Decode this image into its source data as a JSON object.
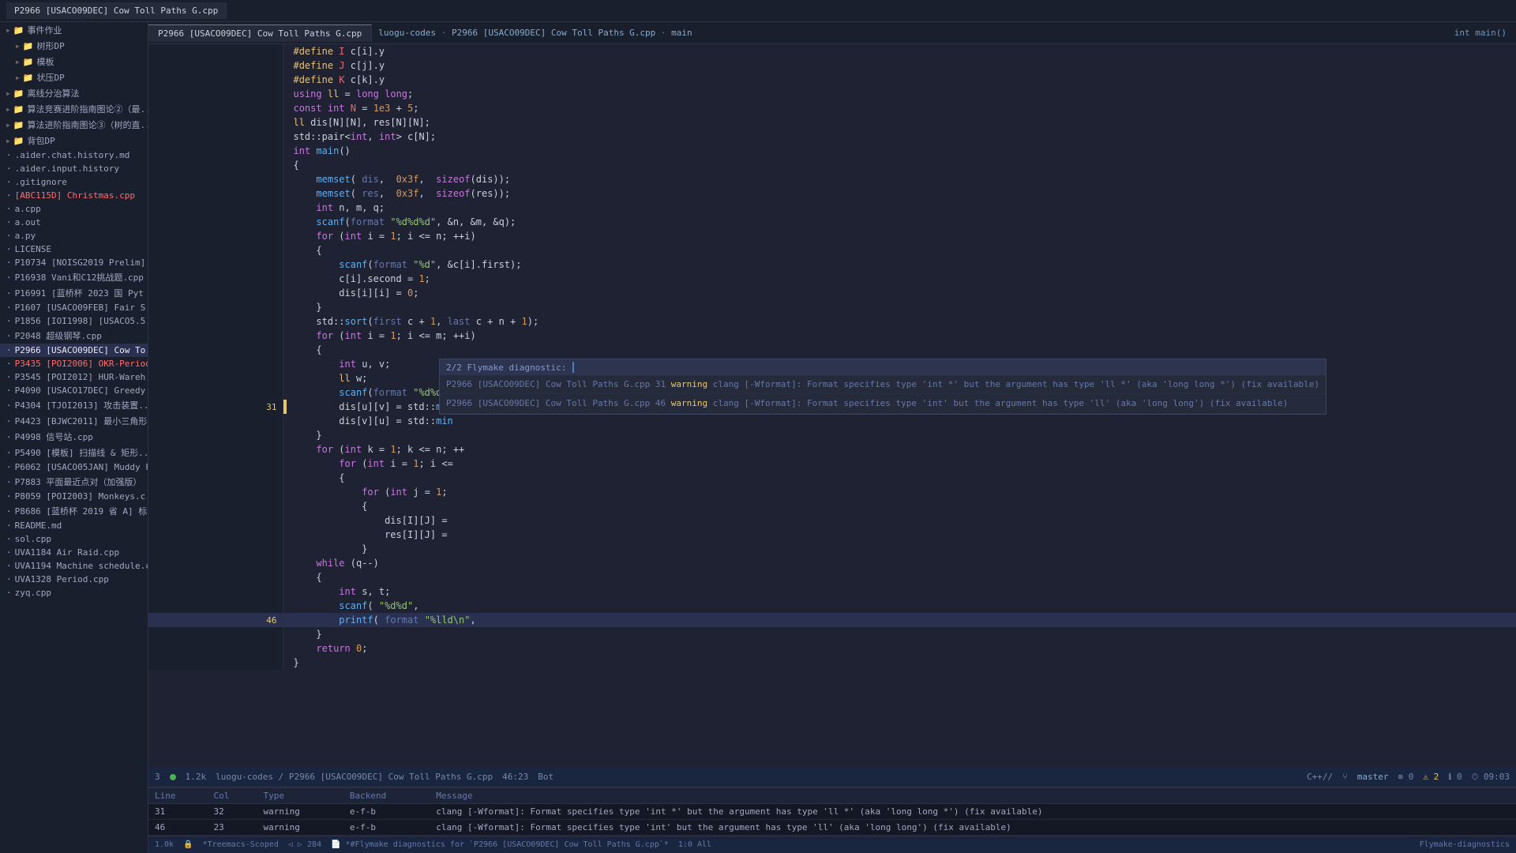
{
  "titleBar": {
    "tab": "P2966 [USACO09DEC] Cow Toll Paths G.cpp"
  },
  "tabBar": {
    "tabs": [
      {
        "label": "P2966 [USACO09DEC] Cow Toll Paths G.cpp",
        "active": true
      },
      {
        "label": "main",
        "active": false
      }
    ],
    "breadcrumb": "luogu-codes · P2966 [USACO09DEC] Cow Toll Paths G.cpp · main"
  },
  "sidebar": {
    "items": [
      {
        "label": "事件作业",
        "indent": 0,
        "expandable": true,
        "icon": "folder"
      },
      {
        "label": "树形DP",
        "indent": 1,
        "expandable": true,
        "icon": "folder"
      },
      {
        "label": "模板",
        "indent": 1,
        "expandable": true,
        "icon": "folder"
      },
      {
        "label": "状压DP",
        "indent": 1,
        "expandable": true,
        "icon": "folder"
      },
      {
        "label": "离线分治算法",
        "indent": 0,
        "expandable": true,
        "icon": "folder"
      },
      {
        "label": "算法竞赛进阶指南图论②（最...",
        "indent": 0,
        "expandable": true,
        "icon": "folder"
      },
      {
        "label": "算法进阶指南图论③（树的直...",
        "indent": 0,
        "expandable": true,
        "icon": "folder"
      },
      {
        "label": "背包DP",
        "indent": 0,
        "expandable": true,
        "icon": "folder"
      },
      {
        "label": ".aider.chat.history.md",
        "indent": 0,
        "icon": "file"
      },
      {
        "label": ".aider.input.history",
        "indent": 0,
        "icon": "file"
      },
      {
        "label": ".gitignore",
        "indent": 0,
        "icon": "file"
      },
      {
        "label": "[ABC115D] Christmas.cpp",
        "indent": 0,
        "icon": "file",
        "highlighted": true
      },
      {
        "label": "a.cpp",
        "indent": 0,
        "icon": "file"
      },
      {
        "label": "a.out",
        "indent": 0,
        "icon": "file"
      },
      {
        "label": "a.py",
        "indent": 0,
        "icon": "file"
      },
      {
        "label": "LICENSE",
        "indent": 0,
        "icon": "file"
      },
      {
        "label": "P10734 [NOISG2019 Prelim]...",
        "indent": 0,
        "icon": "file"
      },
      {
        "label": "P16938 Vani和C12挑战题.cpp",
        "indent": 0,
        "icon": "file"
      },
      {
        "label": "P16991 [蓝桥杯 2023 国 Pyt",
        "indent": 0,
        "icon": "file"
      },
      {
        "label": "P1607 [USACO09FEB] Fair S...",
        "indent": 0,
        "icon": "file"
      },
      {
        "label": "P1856 [IOI1998] [USACO5.5..",
        "indent": 0,
        "icon": "file"
      },
      {
        "label": "P2048 超级钢琴.cpp",
        "indent": 0,
        "icon": "file"
      },
      {
        "label": "P2966 [USACO09DEC] Cow To...",
        "indent": 0,
        "icon": "file",
        "active": true
      },
      {
        "label": "P3435 [POI2006] OKR-Period...",
        "indent": 0,
        "icon": "file",
        "highlighted": true
      },
      {
        "label": "P3545 [POI2012] HUR-Wareh...",
        "indent": 0,
        "icon": "file"
      },
      {
        "label": "P4090 [USACO17DEC] Greedy...",
        "indent": 0,
        "icon": "file"
      },
      {
        "label": "P4304 [TJOI2013] 攻击装置...",
        "indent": 0,
        "icon": "file"
      },
      {
        "label": "P4423 [BJWC2011] 最小三角形...",
        "indent": 0,
        "icon": "file"
      },
      {
        "label": "P4998 信号站.cpp",
        "indent": 0,
        "icon": "file"
      },
      {
        "label": "P5490 [模板] 扫描线 & 矩形...",
        "indent": 0,
        "icon": "file"
      },
      {
        "label": "P6062 [USACO05JAN] Muddy F..",
        "indent": 0,
        "icon": "file"
      },
      {
        "label": "P7883 平面最近点对（加强版）",
        "indent": 0,
        "icon": "file"
      },
      {
        "label": "P8059 [POI2003] Monkeys.c...",
        "indent": 0,
        "icon": "file"
      },
      {
        "label": "P8686 [蓝桥杯 2019 省 A] 标...",
        "indent": 0,
        "icon": "file"
      },
      {
        "label": "README.md",
        "indent": 0,
        "icon": "file"
      },
      {
        "label": "sol.cpp",
        "indent": 0,
        "icon": "file"
      },
      {
        "label": "UVA1184 Air Raid.cpp",
        "indent": 0,
        "icon": "file"
      },
      {
        "label": "UVA1194 Machine schedule.c...",
        "indent": 0,
        "icon": "file"
      },
      {
        "label": "UVA1328 Period.cpp",
        "indent": 0,
        "icon": "file"
      },
      {
        "label": "zyq.cpp",
        "indent": 0,
        "icon": "file"
      }
    ]
  },
  "codeLines": [
    {
      "num": "",
      "content": "#define I c[i].y",
      "type": "code"
    },
    {
      "num": "",
      "content": "#define J c[j].y",
      "type": "code"
    },
    {
      "num": "",
      "content": "#define K c[k].y",
      "type": "code"
    },
    {
      "num": "",
      "content": "using ll = long long;",
      "type": "code",
      "warning": false
    },
    {
      "num": "",
      "content": "const int N = 1e3 + 5;",
      "type": "code"
    },
    {
      "num": "",
      "content": "ll dis[N][N], res[N][N];",
      "type": "code"
    },
    {
      "num": "",
      "content": "std::pair<int, int> c[N];",
      "type": "code"
    },
    {
      "num": "",
      "content": "int main()",
      "type": "code"
    },
    {
      "num": "",
      "content": "{",
      "type": "code"
    },
    {
      "num": "",
      "content": "    memset(dis,  0x3f,  sizeof(dis));",
      "type": "code"
    },
    {
      "num": "",
      "content": "    memset(res,  0x3f,  sizeof(res));",
      "type": "code"
    },
    {
      "num": "",
      "content": "    int n, m, q;",
      "type": "code"
    },
    {
      "num": "",
      "content": "    scanf(\"%d%d%d\", &n, &m, &q);",
      "type": "code"
    },
    {
      "num": "",
      "content": "    for (int i = 1; i <= n; ++i)",
      "type": "code"
    },
    {
      "num": "",
      "content": "    {",
      "type": "code"
    },
    {
      "num": "",
      "content": "        scanf(\"%d\", &c[i].first);",
      "type": "code"
    },
    {
      "num": "",
      "content": "        c[i].second = 1;",
      "type": "code"
    },
    {
      "num": "",
      "content": "        dis[i][i] = 0;",
      "type": "code"
    },
    {
      "num": "",
      "content": "    }",
      "type": "code"
    },
    {
      "num": "",
      "content": "    std::sort(c + 1,  c + n + 1);",
      "type": "code"
    },
    {
      "num": "",
      "content": "    for (int i = 1; i <= m; ++i)",
      "type": "code"
    },
    {
      "num": "",
      "content": "    {",
      "type": "code"
    },
    {
      "num": "",
      "content": "        int u, v;",
      "type": "code"
    },
    {
      "num": "",
      "content": "        ll w;",
      "type": "code"
    },
    {
      "num": "",
      "content": "        scanf(\"%d%d%d\", &u, &v, &w);",
      "type": "code"
    },
    {
      "num": "31",
      "content": "        dis[u][v] = std::min dis[u][v], w);",
      "type": "code",
      "warning": true,
      "active": true
    },
    {
      "num": "",
      "content": "        dis[v][u] = std::min",
      "type": "code"
    },
    {
      "num": "",
      "content": "    }",
      "type": "code"
    },
    {
      "num": "",
      "content": "    for (int k = 1; k <= n; ++",
      "type": "code"
    },
    {
      "num": "",
      "content": "        for (int i = 1; i <=",
      "type": "code"
    },
    {
      "num": "",
      "content": "        {",
      "type": "code"
    },
    {
      "num": "",
      "content": "            for (int j = 1;",
      "type": "code"
    },
    {
      "num": "",
      "content": "            {",
      "type": "code"
    },
    {
      "num": "",
      "content": "                dis[I][J] =",
      "type": "code"
    },
    {
      "num": "",
      "content": "                res[I][J] =",
      "type": "code"
    },
    {
      "num": "",
      "content": "            }",
      "type": "code"
    },
    {
      "num": "",
      "content": "    while (q--)",
      "type": "code"
    },
    {
      "num": "",
      "content": "    {",
      "type": "code"
    },
    {
      "num": "",
      "content": "        int s, t;",
      "type": "code"
    },
    {
      "num": "",
      "content": "        scanf( \"%d%d\",",
      "type": "code"
    },
    {
      "num": "46",
      "content": "        printf( \"%lld\\n\",",
      "type": "code",
      "warning": true,
      "highlighted": true
    },
    {
      "num": "",
      "content": "    }",
      "type": "code"
    },
    {
      "num": "",
      "content": "    return 0;",
      "type": "code"
    },
    {
      "num": "",
      "content": "}",
      "type": "code"
    }
  ],
  "diagnosticPopup": {
    "header": "2/2  Flymake diagnostic:",
    "rows": [
      {
        "file": "P2966 [USACO09DEC] Cow Toll Paths G.cpp",
        "line": "31",
        "type": "warning",
        "backend": "clang",
        "message": "[-Wformat]: Format specifies type 'int *' but the argument has type 'll *' (aka 'long long *') (fix available)"
      },
      {
        "file": "P2966 [USACO09DEC] Cow Toll Paths G.cpp",
        "line": "46",
        "type": "warning",
        "backend": "clang",
        "message": "[-Wformat]: Format specifies type 'int' but the argument has type 'll' (aka 'long long') (fix available)"
      }
    ]
  },
  "statusBar1": {
    "num": "3",
    "speed": "1.2k",
    "path": "luogu-codes/P2966 [USACO09DEC] Cow Toll Paths G.cpp",
    "time": "46:23",
    "user": "Bot",
    "lang": "C++//",
    "branch": "master",
    "errors": "0",
    "warnings": "2",
    "infos": "0",
    "clock": "09:03"
  },
  "diagnosticsPanel": {
    "columns": [
      "Line",
      "Col",
      "Type",
      "Backend",
      "Message"
    ],
    "rows": [
      {
        "line": "31",
        "col": "32",
        "type": "warning",
        "backend": "e-f-b",
        "message": "clang [-Wformat]: Format specifies type 'int *' but the argument has type 'll *' (aka 'long long *') (fix available)"
      },
      {
        "line": "46",
        "col": "23",
        "type": "warning",
        "backend": "e-f-b",
        "message": "clang [-Wformat]: Format specifies type 'int' but the argument has type 'll' (aka 'long long') (fix available)"
      }
    ]
  },
  "statusBar2": {
    "left": [
      "1.0k",
      "#Treemacs-Scoped",
      "284",
      "#Flymake diagnostics for `P2966 [USACO09DEC] Cow Toll Paths G.cpp`*",
      "1:0 All"
    ],
    "right": "Flymake-diagnostics"
  }
}
